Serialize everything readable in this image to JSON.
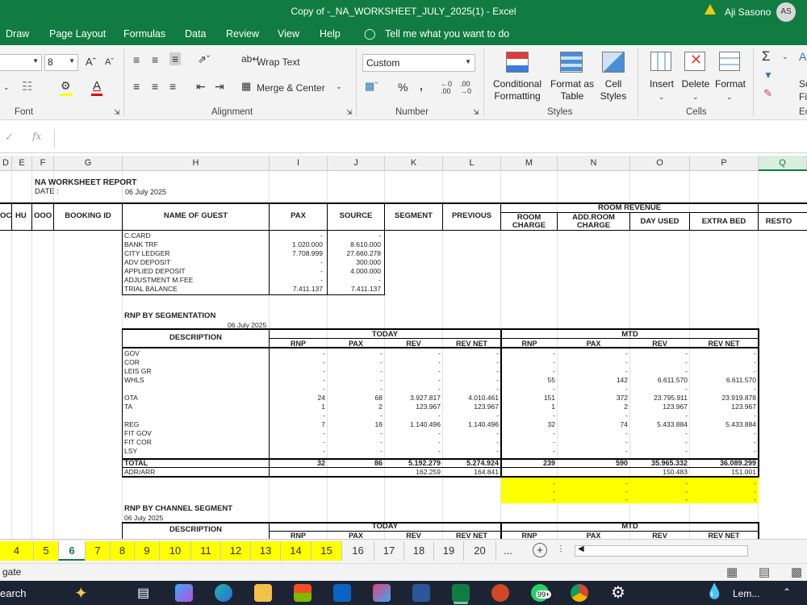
{
  "window": {
    "title": "Copy of -_NA_WORKSHEET_JULY_2025(1)  -  Excel",
    "user": "Aji Sasono",
    "user_initials": "AS"
  },
  "menu": [
    "Draw",
    "Page Layout",
    "Formulas",
    "Data",
    "Review",
    "View",
    "Help",
    "Tell me what you want to do"
  ],
  "ribbon": {
    "font_size": "8",
    "number_format": "Custom",
    "wrap_text": "Wrap Text",
    "merge_center": "Merge & Center",
    "conditional_formatting": "Conditional\nFormatting",
    "format_as_table": "Format as\nTable",
    "cell_styles": "Cell\nStyles",
    "insert": "Insert",
    "delete": "Delete",
    "format": "Format",
    "groups": {
      "font": "Font",
      "alignment": "Alignment",
      "number": "Number",
      "styles": "Styles",
      "cells": "Cells"
    },
    "cut_edge_1": "So",
    "cut_edge_2": "Fi",
    "cut_edge_3": "Ec"
  },
  "formula_bar": {
    "fx": "fx",
    "content": ""
  },
  "columns": [
    "D",
    "E",
    "F",
    "G",
    "H",
    "I",
    "J",
    "K",
    "L",
    "M",
    "N",
    "O",
    "P",
    "Q"
  ],
  "report": {
    "title": "NA WORKSHEET REPORT",
    "date_label": "DATE :",
    "date": "06 July 2025",
    "headers": {
      "oc": "OC",
      "hu": "HU",
      "ooo": "OOO",
      "booking_id": "BOOKING ID",
      "name_of_guest": "NAME OF GUEST",
      "pax": "PAX",
      "source": "SOURCE",
      "segment": "SEGMENT",
      "previous": "PREVIOUS",
      "room_revenue": "ROOM REVENUE",
      "room_charge": "ROOM\nCHARGE",
      "add_room_charge": "ADD.ROOM\nCHARGE",
      "day_used": "DAY USED",
      "extra_bed": "EXTRA BED",
      "resto": "RESTO"
    },
    "ledger": [
      {
        "label": "C.CARD",
        "pax": "-",
        "source": "-"
      },
      {
        "label": "BANK TRF",
        "pax": "1.020.000",
        "source": "8.610.000"
      },
      {
        "label": "CITY LEDGER",
        "pax": "7.708.999",
        "source": "27.660.278"
      },
      {
        "label": "ADV DEPOSIT",
        "pax": "-",
        "source": "300.000"
      },
      {
        "label": "APPLIED DEPOSIT",
        "pax": "-",
        "source": "4.000.000"
      },
      {
        "label": "ADJUSTMENT M.FEE",
        "pax": "-",
        "source": "-"
      },
      {
        "label": "TRIAL BALANCE",
        "pax": "7.411.137",
        "source": "7.411.137"
      }
    ]
  },
  "segmentation": {
    "title": "RNP BY SEGMENTATION",
    "date": "06 July 2025",
    "description": "DESCRIPTION",
    "today": "TODAY",
    "mtd": "MTD",
    "cols": [
      "RNP",
      "PAX",
      "REV",
      "REV NET",
      "RNP",
      "PAX",
      "REV",
      "REV NET"
    ],
    "rows": [
      {
        "label": "GOV",
        "v": [
          "-",
          "-",
          "-",
          "-",
          "-",
          "-",
          "-",
          "-"
        ]
      },
      {
        "label": "COR",
        "v": [
          "-",
          "-",
          "-",
          "-",
          "-",
          "-",
          "-",
          "-"
        ]
      },
      {
        "label": "LEIS GR",
        "v": [
          "-",
          "-",
          "-",
          "-",
          "-",
          "-",
          "-",
          "-"
        ]
      },
      {
        "label": "WHLS",
        "v": [
          "-",
          "-",
          "-",
          "-",
          "55",
          "142",
          "6.611.570",
          "6.611.570"
        ]
      },
      {
        "label": "",
        "v": [
          "-",
          "-",
          "-",
          "-",
          "-",
          "-",
          "-",
          "-"
        ]
      },
      {
        "label": "OTA",
        "v": [
          "24",
          "68",
          "3.927.817",
          "4.010.461",
          "151",
          "372",
          "23.795.911",
          "23.919.878"
        ]
      },
      {
        "label": "TA",
        "v": [
          "1",
          "2",
          "123.967",
          "123.967",
          "1",
          "2",
          "123.967",
          "123.967"
        ]
      },
      {
        "label": "",
        "v": [
          "-",
          "-",
          "-",
          "-",
          "-",
          "-",
          "-",
          "-"
        ]
      },
      {
        "label": "REG",
        "v": [
          "7",
          "16",
          "1.140.496",
          "1.140.496",
          "32",
          "74",
          "5.433.884",
          "5.433.884"
        ]
      },
      {
        "label": "FIT GOV",
        "v": [
          "-",
          "-",
          "-",
          "-",
          "-",
          "-",
          "-",
          "-"
        ]
      },
      {
        "label": "FIT COR",
        "v": [
          "-",
          "-",
          "-",
          "-",
          "-",
          "-",
          "-",
          "-"
        ]
      },
      {
        "label": "LSY",
        "v": [
          "-",
          "-",
          "-",
          "-",
          "-",
          "-",
          "-",
          "-"
        ]
      }
    ],
    "total": {
      "label": "TOTAL",
      "v": [
        "32",
        "86",
        "5.192.279",
        "5.274.924",
        "239",
        "590",
        "35.965.332",
        "36.089.299"
      ]
    },
    "adr": {
      "label": "ADR/ARR",
      "v": [
        "",
        "",
        "162.259",
        "164.841",
        "",
        "",
        "150.483",
        "151.001"
      ]
    },
    "yellow_dashes": [
      "-",
      "-",
      "-",
      "-"
    ]
  },
  "channel": {
    "title": "RNP BY CHANNEL SEGMENT",
    "date": "06 July 2025",
    "description": "DESCRIPTION",
    "today": "TODAY",
    "mtd": "MTD",
    "cols": [
      "RNP",
      "PAX",
      "REV",
      "REV NET",
      "RNP",
      "PAX",
      "REV",
      "REV NET"
    ]
  },
  "sheet_tabs": [
    "4",
    "5",
    "6",
    "7",
    "8",
    "9",
    "10",
    "11",
    "12",
    "13",
    "14",
    "15",
    "16",
    "17",
    "18",
    "19",
    "20",
    "..."
  ],
  "status": {
    "left": "gate"
  },
  "taskbar": {
    "search": "earch",
    "weather": "Lem...",
    "notif": "99+"
  }
}
